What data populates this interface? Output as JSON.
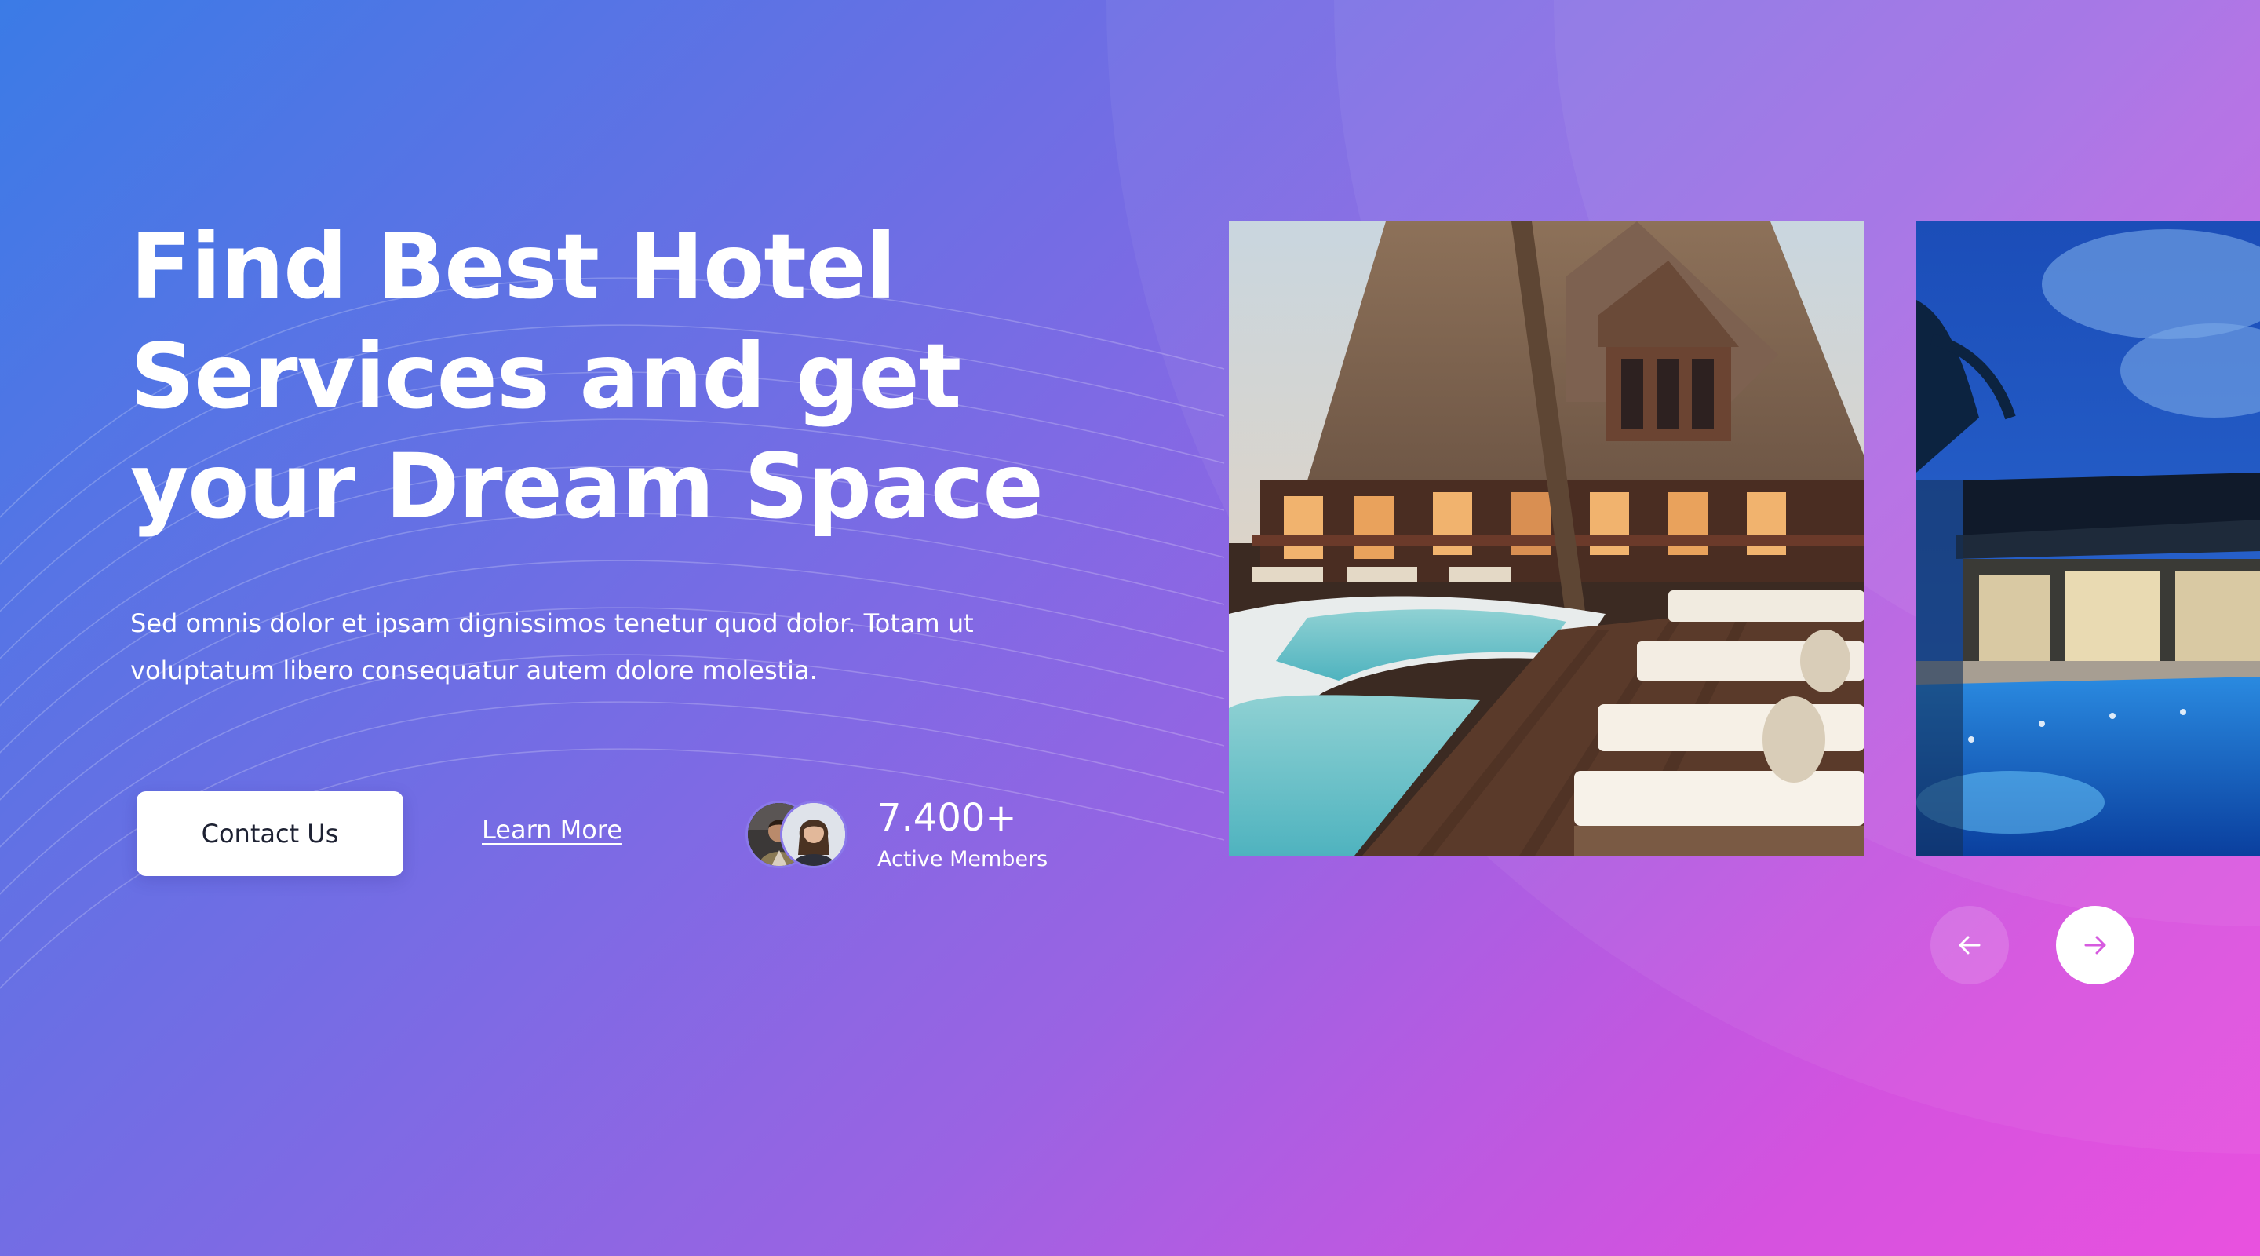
{
  "hero": {
    "title_lines": [
      "Find Best Hotel",
      "Services and get",
      "your Dream Space"
    ],
    "description_line1": "Sed omnis dolor et ipsam dignissimos tenetur quod dolor. Totam ut",
    "description_line2": "voluptatum libero consequatur autem dolore molestia.",
    "primary_button_label": "Contact Us",
    "secondary_link_label": "Learn More"
  },
  "members": {
    "count": "7.400+",
    "label": "Active Members",
    "avatars": [
      "avatar-man",
      "avatar-woman"
    ]
  },
  "carousel": {
    "slides": [
      {
        "image": "resort-lodge-poolside-photo"
      },
      {
        "image": "modern-villa-pool-night-photo"
      }
    ],
    "prev_icon": "arrow-left-icon",
    "next_icon": "arrow-right-icon"
  },
  "colors": {
    "gradient_start": "#3b7be6",
    "gradient_mid": "#9a63e3",
    "gradient_end": "#e951df",
    "button_bg": "#ffffff",
    "button_text": "#1e2233",
    "arrow_accent": "#d65bdf"
  }
}
